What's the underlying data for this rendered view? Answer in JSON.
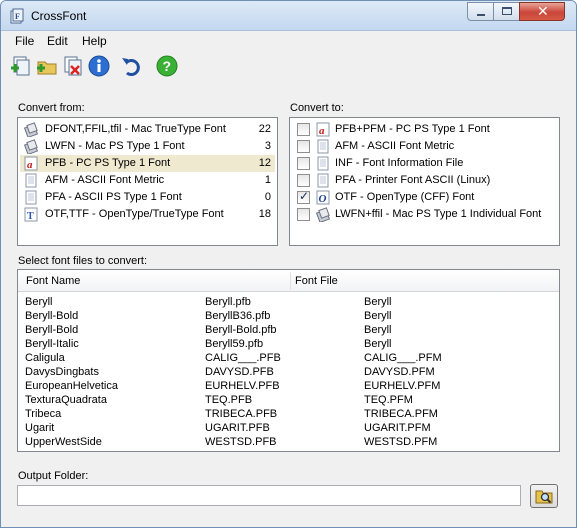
{
  "window": {
    "title": "CrossFont"
  },
  "menu": [
    "File",
    "Edit",
    "Help"
  ],
  "toolbar": {
    "buttons": [
      {
        "name": "add-files-icon"
      },
      {
        "name": "add-folder-icon"
      },
      {
        "name": "remove-files-icon"
      },
      {
        "name": "info-icon"
      },
      {
        "name": "undo-icon"
      },
      {
        "name": "help-icon"
      }
    ]
  },
  "convert_from": {
    "label": "Convert from:",
    "items": [
      {
        "icon": "mac-font-icon",
        "label": "DFONT,FFIL,tfil - Mac TrueType Font",
        "count": "22",
        "selected": false
      },
      {
        "icon": "mac-font-icon",
        "label": "LWFN - Mac PS Type 1 Font",
        "count": "3",
        "selected": false
      },
      {
        "icon": "ps-type1-font-icon",
        "label": "PFB - PC PS Type 1 Font",
        "count": "12",
        "selected": true
      },
      {
        "icon": "doc-icon",
        "label": "AFM - ASCII Font Metric",
        "count": "1",
        "selected": false
      },
      {
        "icon": "doc-icon",
        "label": "PFA - ASCII PS Type 1 Font",
        "count": "0",
        "selected": false
      },
      {
        "icon": "truetype-font-icon",
        "label": "OTF,TTF - OpenType/TrueType Font",
        "count": "18",
        "selected": false
      }
    ]
  },
  "convert_to": {
    "label": "Convert to:",
    "items": [
      {
        "icon": "ps-type1-font-icon",
        "label": "PFB+PFM - PC PS Type 1 Font",
        "checked": false
      },
      {
        "icon": "doc-icon",
        "label": "AFM - ASCII Font Metric",
        "checked": false
      },
      {
        "icon": "doc-icon",
        "label": "INF - Font Information File",
        "checked": false
      },
      {
        "icon": "doc-icon",
        "label": "PFA - Printer Font ASCII (Linux)",
        "checked": false
      },
      {
        "icon": "opentype-font-icon",
        "label": "OTF - OpenType (CFF) Font",
        "checked": true
      },
      {
        "icon": "mac-font-icon",
        "label": "LWFN+ffil - Mac PS Type 1 Individual Font",
        "checked": false
      }
    ]
  },
  "files": {
    "label": "Select font files to convert:",
    "columns": [
      "Font Name",
      "Font File"
    ],
    "rows": [
      [
        "Beryll",
        "Beryll.pfb",
        "Beryll"
      ],
      [
        "Beryll-Bold",
        "BeryllB36.pfb",
        "Beryll"
      ],
      [
        "Beryll-Bold",
        "Beryll-Bold.pfb",
        "Beryll"
      ],
      [
        "Beryll-Italic",
        "Beryll59.pfb",
        "Beryll"
      ],
      [
        "Caligula",
        "CALIG___.PFB",
        "CALIG___.PFM"
      ],
      [
        "DavysDingbats",
        "DAVYSD.PFB",
        "DAVYSD.PFM"
      ],
      [
        "EuropeanHelvetica",
        "EURHELV.PFB",
        "EURHELV.PFM"
      ],
      [
        "TexturaQuadrata",
        "TEQ.PFB",
        "TEQ.PFM"
      ],
      [
        "Tribeca",
        "TRIBECA.PFB",
        "TRIBECA.PFM"
      ],
      [
        "Ugarit",
        "UGARIT.PFB",
        "UGARIT.PFM"
      ],
      [
        "UpperWestSide",
        "WESTSD.PFB",
        "WESTSD.PFM"
      ]
    ]
  },
  "output": {
    "label": "Output Folder:",
    "value": ""
  }
}
